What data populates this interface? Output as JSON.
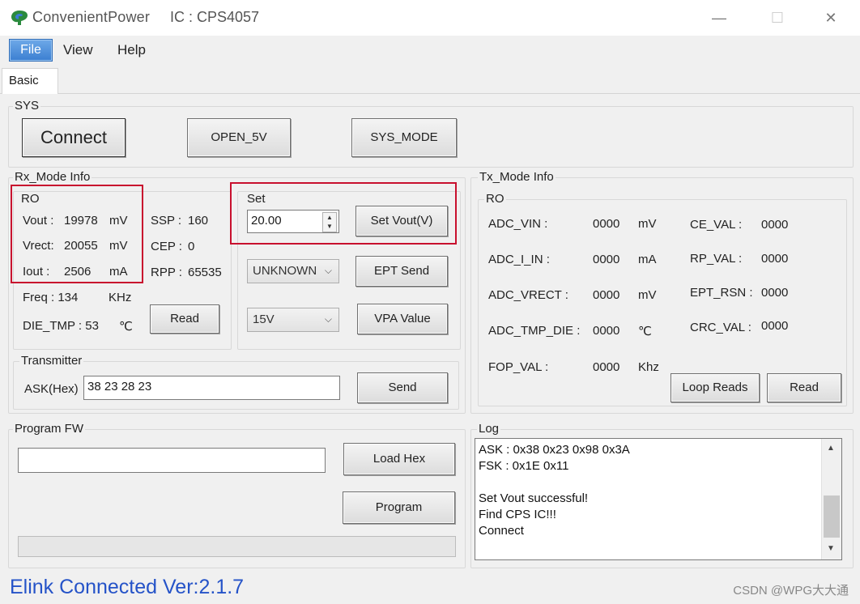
{
  "window": {
    "app_name": "ConvenientPower",
    "ic": "IC : CPS4057",
    "minimize": "—",
    "maximize": "☐",
    "close": "✕"
  },
  "menu": {
    "file": "File",
    "view": "View",
    "help": "Help"
  },
  "tabs": {
    "basic": "Basic"
  },
  "sys": {
    "title": "SYS",
    "connect": "Connect",
    "open5v": "OPEN_5V",
    "sysmode": "SYS_MODE"
  },
  "rx": {
    "title": "Rx_Mode Info",
    "ro_title": "RO",
    "vout_label": "Vout :",
    "vout_value": "19978",
    "vout_unit": "mV",
    "vrect_label": "Vrect:",
    "vrect_value": "20055",
    "vrect_unit": "mV",
    "iout_label": "Iout :",
    "iout_value": "2506",
    "iout_unit": "mA",
    "ssp_label": "SSP :",
    "ssp_value": "160",
    "cep_label": "CEP :",
    "cep_value": "0",
    "rpp_label": "RPP :",
    "rpp_value": "65535",
    "freq_label": "Freq : 134",
    "freq_unit": "KHz",
    "dietmp_label": "DIE_TMP : 53",
    "dietmp_unit": "℃",
    "read": "Read"
  },
  "set": {
    "title": "Set",
    "vout_value": "20.00",
    "set_vout": "Set Vout(V)",
    "mode_select": "UNKNOWN",
    "ept_send": "EPT Send",
    "voltage_select": "15V",
    "vpa_value": "VPA Value"
  },
  "transmitter": {
    "title": "Transmitter",
    "ask_label": "ASK(Hex)",
    "ask_value": "38 23 28 23",
    "send": "Send"
  },
  "tx": {
    "title": "Tx_Mode Info",
    "ro_title": "RO",
    "adc_vin_label": "ADC_VIN :",
    "adc_vin_value": "0000",
    "adc_vin_unit": "mV",
    "adc_iin_label": "ADC_I_IN :",
    "adc_iin_value": "0000",
    "adc_iin_unit": "mA",
    "adc_vrect_label": "ADC_VRECT :",
    "adc_vrect_value": "0000",
    "adc_vrect_unit": "mV",
    "adc_tmp_label": "ADC_TMP_DIE :",
    "adc_tmp_value": "0000",
    "adc_tmp_unit": "℃",
    "fop_label": "FOP_VAL :",
    "fop_value": "0000",
    "fop_unit": "Khz",
    "ce_label": "CE_VAL :",
    "ce_value": "0000",
    "rp_label": "RP_VAL :",
    "rp_value": "0000",
    "ept_rsn_label": "EPT_RSN :",
    "ept_rsn_value": "0000",
    "crc_label": "CRC_VAL :",
    "crc_value": "0000",
    "loop_reads": "Loop Reads",
    "read": "Read"
  },
  "program": {
    "title": "Program FW",
    "path_value": "",
    "load_hex": "Load Hex",
    "program": "Program"
  },
  "log": {
    "title": "Log",
    "lines": [
      "ASK : 0x38 0x23 0x98 0x3A",
      "FSK :  0x1E 0x11",
      "",
      "Set Vout successful!",
      "Find CPS IC!!!",
      "Connect"
    ]
  },
  "status": {
    "text": "Elink Connected Ver:2.1.7"
  },
  "watermark": "CSDN @WPG大大通",
  "colors": {
    "highlight_red": "#c8102e",
    "status_blue": "#2553c8",
    "menu_active": "#3b7fd1"
  }
}
